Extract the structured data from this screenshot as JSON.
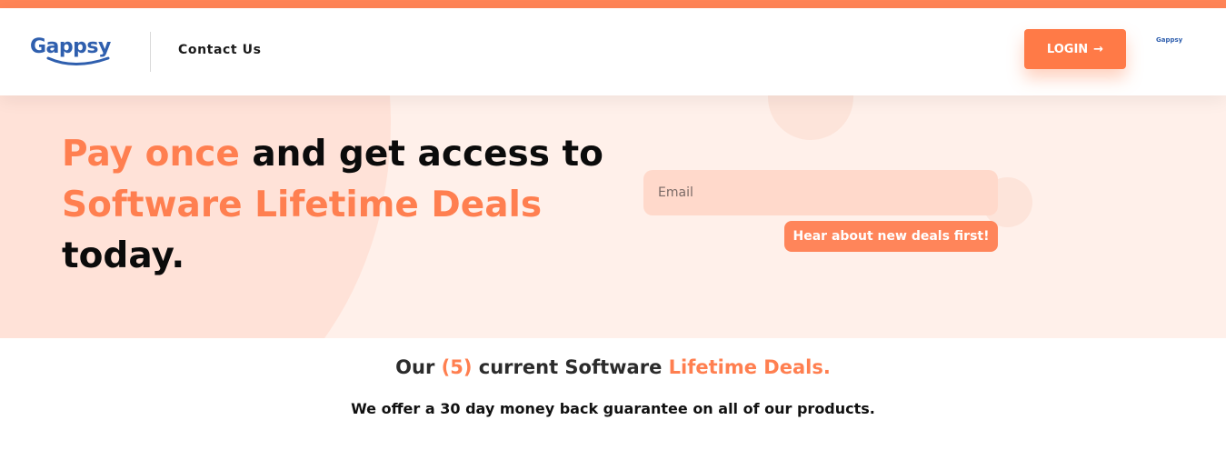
{
  "header": {
    "logo_text": "Gappsy",
    "nav_contact": "Contact Us",
    "login_label": "LOGIN",
    "login_icon": "arrow-right-icon",
    "mini_logo_text": "Gappsy"
  },
  "hero": {
    "heading_accent_1": "Pay once",
    "heading_plain_1": " and get access to",
    "heading_accent_2": "Software Lifetime Deals",
    "heading_plain_2": "today.",
    "email_placeholder": "Email",
    "subscribe_label": "Hear about new deals first!"
  },
  "deals": {
    "title_prefix": "Our ",
    "title_count": "(5)",
    "title_middle": " current Software ",
    "title_accent": "Lifetime Deals.",
    "subtitle": "We offer a 30 day money back guarantee on all of our products."
  },
  "colors": {
    "accent": "#ff7f50",
    "brand_blue": "#2f5fae",
    "hero_bg": "#fff0ea"
  }
}
